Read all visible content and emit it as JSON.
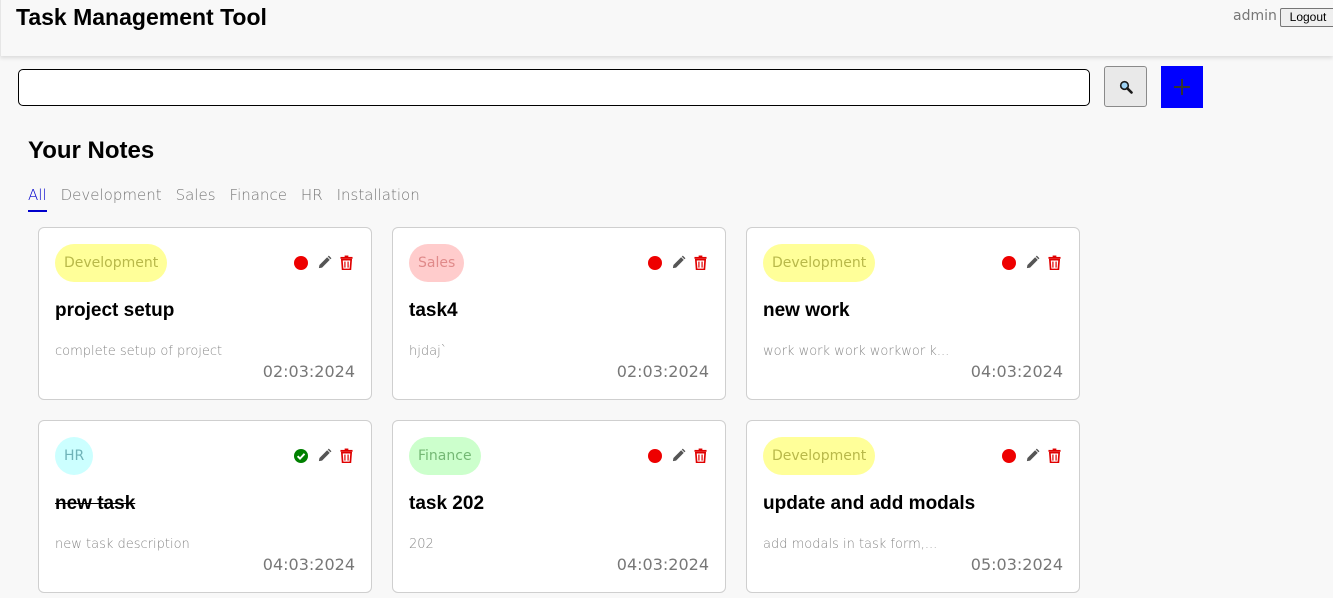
{
  "header": {
    "title": "Task Management Tool",
    "user": "admin",
    "logout_label": "Logout"
  },
  "search": {
    "value": "",
    "placeholder": "",
    "search_icon": "magnifier-icon",
    "add_icon": "plus-icon"
  },
  "section_title": "Your Notes",
  "tabs": [
    {
      "label": "All",
      "active": true
    },
    {
      "label": "Development",
      "active": false
    },
    {
      "label": "Sales",
      "active": false
    },
    {
      "label": "Finance",
      "active": false
    },
    {
      "label": "HR",
      "active": false
    },
    {
      "label": "Installation",
      "active": false
    }
  ],
  "category_colors": {
    "Development": {
      "bg": "#ffff99",
      "fg": "#b8b84a"
    },
    "Sales": {
      "bg": "#ffcccc",
      "fg": "#e08a8a"
    },
    "HR": {
      "bg": "#ccffff",
      "fg": "#6fb3b8"
    },
    "Finance": {
      "bg": "#ccffcc",
      "fg": "#74b874"
    }
  },
  "status_colors": {
    "pending": "#ee0000",
    "completed": "#008000"
  },
  "notes": [
    {
      "category": "Development",
      "title": "project setup",
      "description": "complete setup of project",
      "date": "02:03:2024",
      "status": "pending"
    },
    {
      "category": "Sales",
      "title": "task4",
      "description": "hjdaj`",
      "date": "02:03:2024",
      "status": "pending"
    },
    {
      "category": "Development",
      "title": "new work",
      "description": "work work work workwor k...",
      "date": "04:03:2024",
      "status": "pending"
    },
    {
      "category": "HR",
      "title": "new task",
      "description": "new task description",
      "date": "04:03:2024",
      "status": "completed"
    },
    {
      "category": "Finance",
      "title": "task 202",
      "description": "202",
      "date": "04:03:2024",
      "status": "pending"
    },
    {
      "category": "Development",
      "title": "update and add modals",
      "description": "add modals in task form,...",
      "date": "05:03:2024",
      "status": "pending"
    }
  ]
}
